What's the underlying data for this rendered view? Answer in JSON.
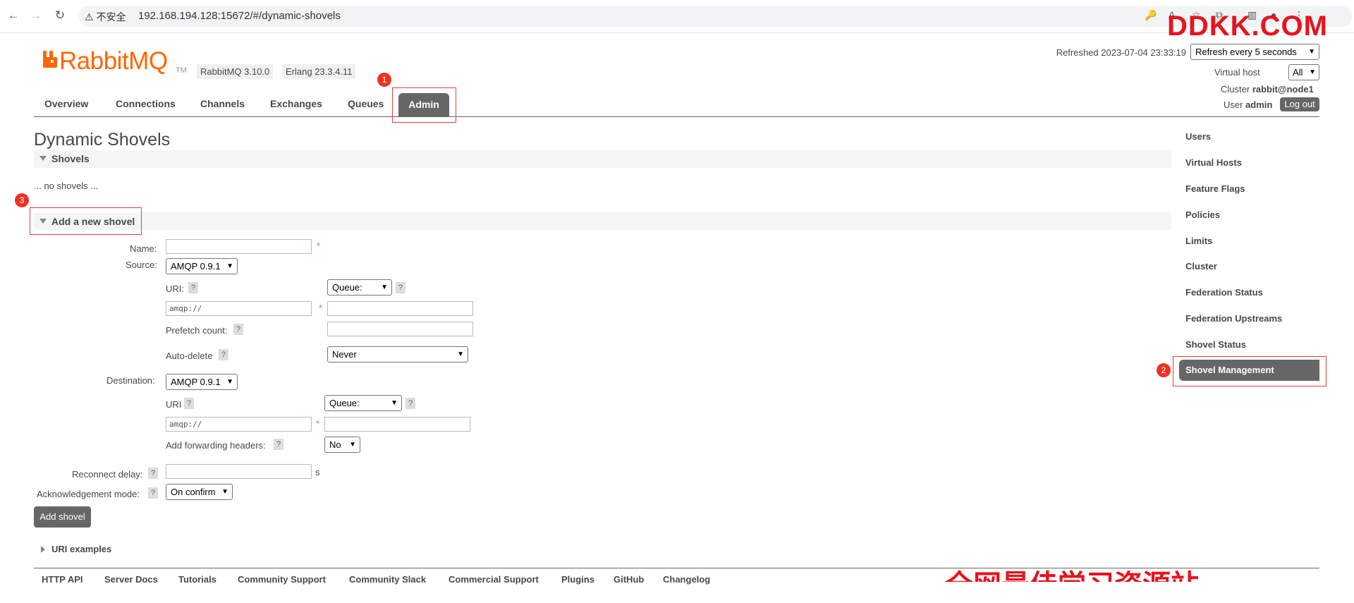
{
  "browser": {
    "security_label": "不安全",
    "url": "192.168.194.128:15672/#/dynamic-shovels",
    "watermark_top": "DDKK.COM",
    "watermark_bottom": "全网最佳学习资源站"
  },
  "header": {
    "logo_text": "RabbitMQ",
    "logo_tm": "TM",
    "rabbitmq_version": "RabbitMQ 3.10.0",
    "erlang_version": "Erlang 23.3.4.11",
    "refreshed": "Refreshed 2023-07-04 23:33:19",
    "refresh_option": "Refresh every 5 seconds",
    "virtual_host_label": "Virtual host",
    "virtual_host_value": "All",
    "cluster_label": "Cluster",
    "cluster_value": "rabbit@node1",
    "user_label": "User",
    "user_value": "admin",
    "logout_label": "Log out"
  },
  "nav": {
    "tabs": [
      "Overview",
      "Connections",
      "Channels",
      "Exchanges",
      "Queues",
      "Admin"
    ],
    "active": "Admin"
  },
  "annotations": [
    "1",
    "2",
    "3"
  ],
  "main": {
    "title": "Dynamic Shovels",
    "shovels_section": "Shovels",
    "no_shovels": "... no shovels ...",
    "add_section": "Add a new shovel",
    "form": {
      "name_label": "Name:",
      "name_value": "",
      "required_mark": "*",
      "source_label": "Source:",
      "source_protocol": "AMQP 0.9.1",
      "source_uri_label": "URI:",
      "source_uri_placeholder": "amqp://",
      "source_type": "Queue:",
      "prefetch_label": "Prefetch count:",
      "auto_delete_label": "Auto-delete",
      "auto_delete_value": "Never",
      "destination_label": "Destination:",
      "destination_protocol": "AMQP 0.9.1",
      "dest_uri_label": "URI",
      "dest_uri_placeholder": "amqp://",
      "dest_type": "Queue:",
      "forwarding_headers_label": "Add forwarding headers:",
      "forwarding_headers_value": "No",
      "reconnect_delay_label": "Reconnect delay:",
      "reconnect_unit": "s",
      "ack_mode_label": "Acknowledgement mode:",
      "ack_mode_value": "On confirm",
      "help_mark": "?",
      "submit_label": "Add shovel"
    },
    "uri_examples": "URI examples"
  },
  "sidebar": {
    "items": [
      "Users",
      "Virtual Hosts",
      "Feature Flags",
      "Policies",
      "Limits",
      "Cluster",
      "Federation Status",
      "Federation Upstreams",
      "Shovel Status",
      "Shovel Management"
    ],
    "active": "Shovel Management"
  },
  "footer": {
    "links": [
      "HTTP API",
      "Server Docs",
      "Tutorials",
      "Community Support",
      "Community Slack",
      "Commercial Support",
      "Plugins",
      "GitHub",
      "Changelog"
    ]
  }
}
